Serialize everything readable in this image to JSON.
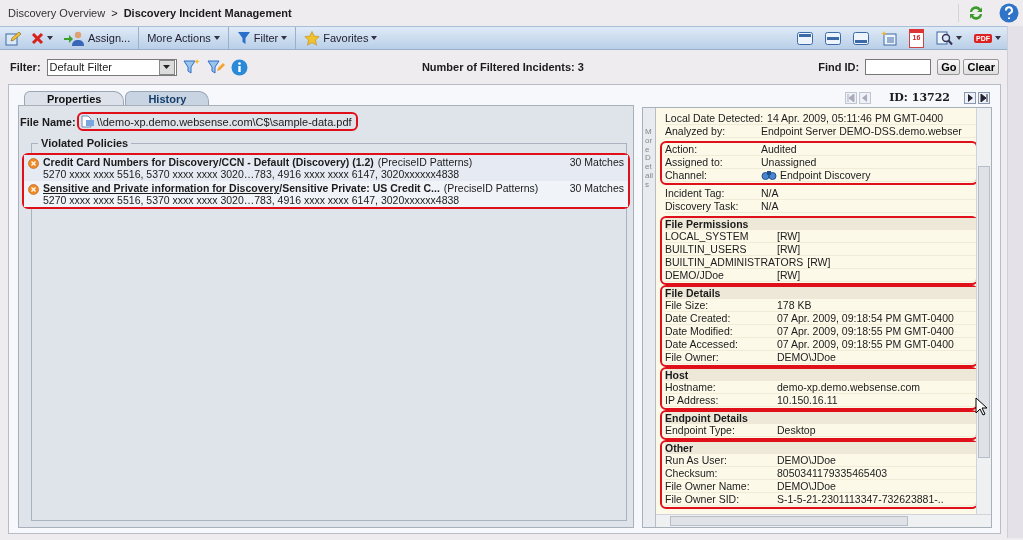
{
  "breadcrumb": {
    "parent": "Discovery Overview",
    "separator": ">",
    "current": "Discovery Incident Management"
  },
  "toolbar": {
    "buttons": [
      {
        "kind": "edit"
      },
      {
        "kind": "delete",
        "menu": true
      },
      {
        "kind": "assign",
        "label": "Assign..."
      },
      {
        "kind": "text",
        "label": "More Actions",
        "menu": true
      },
      {
        "kind": "filter",
        "label": "Filter",
        "menu": true
      },
      {
        "kind": "favorites",
        "label": "Favorites",
        "menu": true
      }
    ],
    "view_buttons": [
      {
        "kind": "layout-top"
      },
      {
        "kind": "layout-middle"
      },
      {
        "kind": "layout-bottom"
      },
      {
        "kind": "new-view"
      },
      {
        "kind": "calendar",
        "label": "16"
      },
      {
        "kind": "search",
        "menu": true
      },
      {
        "kind": "pdf",
        "label": "PDF",
        "menu": true
      }
    ]
  },
  "filter": {
    "label": "Filter:",
    "value": "Default Filter",
    "count_text": "Number of Filtered Incidents: 3",
    "find_label": "Find ID:",
    "go": "Go",
    "clear": "Clear"
  },
  "tabs": [
    {
      "label": "Properties",
      "selected": true
    },
    {
      "label": "History",
      "selected": false
    }
  ],
  "file_name": {
    "label": "File Name:",
    "value": "\\\\demo-xp.demo.websense.com\\C$\\sample-data.pdf",
    "highlighted": true
  },
  "violated_policies": {
    "title": "Violated Policies",
    "highlighted": true,
    "items": [
      {
        "title": "Credit Card Numbers for Discovery/CCN - Default (Discovery) (1.2)",
        "type": "(PreciseID Patterns)",
        "matches": "30 Matches",
        "excerpt": "5270 xxxx xxxx 5516, 5370 xxxx xxxx 3020…783, 4916 xxxx xxxx 6147, 3020xxxxxx4838"
      },
      {
        "link": "Sensitive and Private information for Discovery",
        "title": "/Sensitive Private: US Credit C...",
        "type": "(PreciseID Patterns)",
        "matches": "30 Matches",
        "excerpt": "5270 xxxx xxxx 5516, 5370 xxxx xxxx 3020…783, 4916 xxxx xxxx 6147, 3020xxxxxx4838"
      }
    ]
  },
  "navigator": {
    "id": "ID: 13722"
  },
  "more_details": {
    "tab_label": "More Details"
  },
  "details": [
    {
      "highlighted": false,
      "rows": [
        {
          "label": "Local Date Detected:",
          "value": "14 Apr. 2009, 05:11:46 PM GMT-0400"
        },
        {
          "label": "Analyzed by:",
          "value": "Endpoint Server DEMO-DSS.demo.webser"
        }
      ]
    },
    {
      "highlighted": true,
      "rows": [
        {
          "label": "Action:",
          "value": "Audited"
        },
        {
          "label": "Assigned to:",
          "value": "Unassigned"
        },
        {
          "label": "Channel:",
          "value": "Endpoint Discovery",
          "icon": true
        }
      ]
    },
    {
      "highlighted": false,
      "rows": [
        {
          "label": "Incident Tag:",
          "value": "N/A"
        },
        {
          "label": "Discovery Task:",
          "value": "N/A"
        }
      ]
    },
    {
      "heading": "File Permissions",
      "highlighted": true,
      "rows": [
        {
          "label": "LOCAL_SYSTEM",
          "value": "[RW]"
        },
        {
          "label": "BUILTIN_USERS",
          "value": "[RW]"
        },
        {
          "label": "BUILTIN_ADMINISTRATORS",
          "value": "[RW]"
        },
        {
          "label": "DEMO/JDoe",
          "value": "[RW]"
        }
      ]
    },
    {
      "heading": "File Details",
      "highlighted": true,
      "rows": [
        {
          "label": "File Size:",
          "value": "178 KB"
        },
        {
          "label": "Date Created:",
          "value": "07 Apr. 2009, 09:18:54 PM GMT-0400"
        },
        {
          "label": "Date Modified:",
          "value": "07 Apr. 2009, 09:18:55 PM GMT-0400"
        },
        {
          "label": "Date Accessed:",
          "value": "07 Apr. 2009, 09:18:55 PM GMT-0400"
        },
        {
          "label": "File Owner:",
          "value": "DEMO\\JDoe"
        }
      ]
    },
    {
      "heading": "Host",
      "highlighted": true,
      "rows": [
        {
          "label": "Hostname:",
          "value": "demo-xp.demo.websense.com"
        },
        {
          "label": "IP Address:",
          "value": "10.150.16.11"
        }
      ]
    },
    {
      "heading": "Endpoint Details",
      "highlighted": true,
      "rows": [
        {
          "label": "Endpoint Type:",
          "value": "Desktop"
        }
      ]
    },
    {
      "heading": "Other",
      "highlighted": true,
      "rows": [
        {
          "label": "Run As User:",
          "value": "DEMO\\JDoe"
        },
        {
          "label": "Checksum:",
          "value": "8050341179335465403"
        },
        {
          "label": "File Owner Name:",
          "value": "DEMO\\JDoe"
        },
        {
          "label": "File Owner SID:",
          "value": "S-1-5-21-2301113347-732623881-.."
        }
      ]
    }
  ]
}
